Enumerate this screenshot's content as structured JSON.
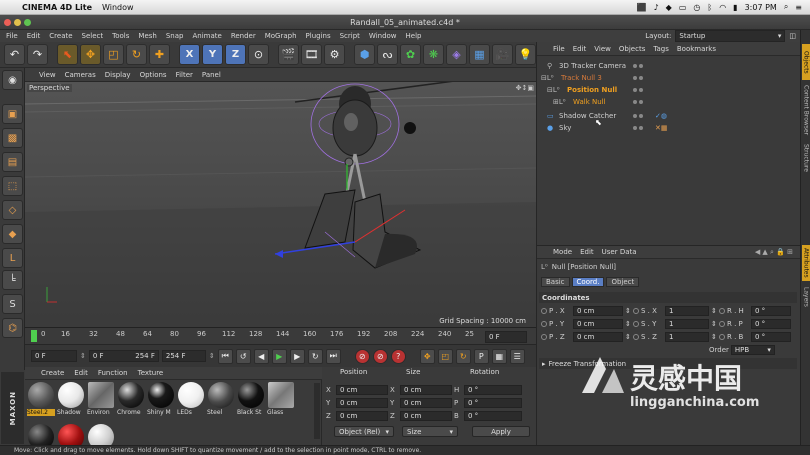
{
  "mac": {
    "app_name": "CINEMA 4D Lite",
    "menus": [
      "Window"
    ],
    "time": "3:07 PM"
  },
  "window": {
    "title": "Randall_05_animated.c4d *"
  },
  "main_menu": [
    "File",
    "Edit",
    "Create",
    "Select",
    "Tools",
    "Mesh",
    "Snap",
    "Animate",
    "Render",
    "MoGraph",
    "Plugins",
    "Script",
    "Window",
    "Help"
  ],
  "toolbar": {
    "axis_x": "X",
    "axis_y": "Y",
    "axis_z": "Z"
  },
  "viewport": {
    "menu": [
      "View",
      "Cameras",
      "Display",
      "Options",
      "Filter",
      "Panel"
    ],
    "label": "Perspective",
    "grid_spacing": "Grid Spacing : 10000 cm"
  },
  "timeline": {
    "ticks": [
      "0",
      "16",
      "32",
      "48",
      "64",
      "80",
      "96",
      "112",
      "128",
      "144",
      "160",
      "176",
      "192",
      "208",
      "224",
      "240",
      "25"
    ],
    "current_frame": "0 F",
    "start_frame": "0 F",
    "range_start": "0 F",
    "range_end": "254 F",
    "end_frame": "254 F"
  },
  "materials": {
    "menu": [
      "Create",
      "Edit",
      "Function",
      "Texture"
    ],
    "items": [
      {
        "label": "Steel.2",
        "color": "#5a5a5a"
      },
      {
        "label": "Shadow",
        "color": "#e8e8e8"
      },
      {
        "label": "Environ",
        "color": "#8a8a8a"
      },
      {
        "label": "Chrome",
        "color": "#2a2a2a"
      },
      {
        "label": "Shiny M",
        "color": "#1a1a1a"
      },
      {
        "label": "LEDs",
        "color": "#f0f0f0"
      },
      {
        "label": "Steel",
        "color": "#4a4a4a"
      },
      {
        "label": "Black St",
        "color": "#111111"
      },
      {
        "label": "Glass",
        "color": "#777777"
      }
    ],
    "row2": [
      {
        "color": "#222222"
      },
      {
        "color": "#a01010"
      },
      {
        "color": "#d0d0d0"
      }
    ]
  },
  "coords": {
    "headers": [
      "Position",
      "Size",
      "Rotation"
    ],
    "rows": [
      {
        "axis": "X",
        "pos": "0 cm",
        "size_axis": "X",
        "size": "0 cm",
        "rot_axis": "H",
        "rot": "0 °"
      },
      {
        "axis": "Y",
        "pos": "0 cm",
        "size_axis": "Y",
        "size": "0 cm",
        "rot_axis": "P",
        "rot": "0 °"
      },
      {
        "axis": "Z",
        "pos": "0 cm",
        "size_axis": "Z",
        "size": "0 cm",
        "rot_axis": "B",
        "rot": "0 °"
      }
    ],
    "mode": "Object (Rel)",
    "size_mode": "Size",
    "apply": "Apply"
  },
  "layout": {
    "label": "Layout:",
    "value": "Startup"
  },
  "objects": {
    "menu": [
      "File",
      "Edit",
      "View",
      "Objects",
      "Tags",
      "Bookmarks"
    ],
    "items": [
      {
        "name": "3D Tracker Camera",
        "color": "#d0d0d0"
      },
      {
        "name": "Track Null 3",
        "color": "#d87a3a"
      },
      {
        "name": "Position Null",
        "color": "#f0a020"
      },
      {
        "name": "Walk Null",
        "color": "#f0a020"
      },
      {
        "name": "Shadow Catcher",
        "color": "#d0d0d0"
      },
      {
        "name": "Sky",
        "color": "#d0d0d0"
      }
    ]
  },
  "attributes": {
    "menu": [
      "Mode",
      "Edit",
      "User Data"
    ],
    "object_title": "Null [Position Null]",
    "tabs": [
      "Basic",
      "Coord.",
      "Object"
    ],
    "active_tab": "Coord.",
    "section": "Coordinates",
    "rows": [
      {
        "p": "P . X",
        "pv": "0 cm",
        "s": "S . X",
        "sv": "1",
        "r": "R . H",
        "rv": "0 °"
      },
      {
        "p": "P . Y",
        "pv": "0 cm",
        "s": "S . Y",
        "sv": "1",
        "r": "R . P",
        "rv": "0 °"
      },
      {
        "p": "P . Z",
        "pv": "0 cm",
        "s": "S . Z",
        "sv": "1",
        "r": "R . B",
        "rv": "0 °"
      }
    ],
    "order_label": "Order",
    "order_value": "HPB",
    "freeze": "Freeze Transformation"
  },
  "side_tabs": [
    "Objects",
    "Content Browser",
    "Structure",
    "Attributes",
    "Layers"
  ],
  "status": "Move: Click and drag to move elements. Hold down SHIFT to quantize movement / add to the selection in point mode, CTRL to remove.",
  "watermark": {
    "cn": "灵感中国",
    "url": "lingganchina.com"
  }
}
